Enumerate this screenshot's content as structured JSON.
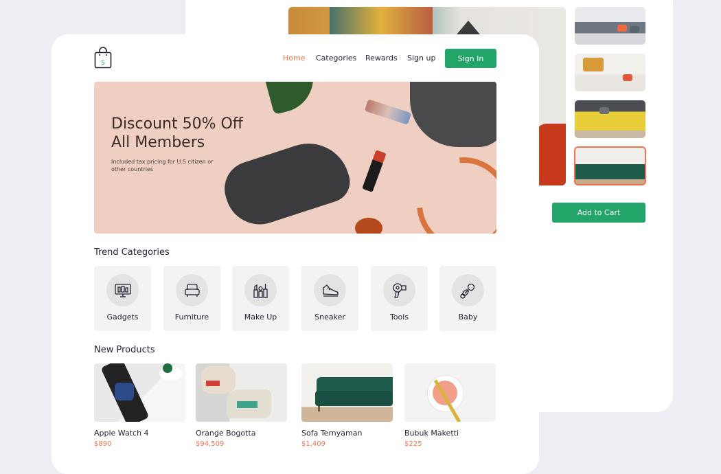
{
  "nav": {
    "items": [
      "Home",
      "Categories",
      "Rewards",
      "Sign up"
    ],
    "signin_label": "Sign In"
  },
  "hero": {
    "title_line1": "Discount 50% Off",
    "title_line2": "All Members",
    "subtitle": "Included tax pricing for U.S citizen or other countries"
  },
  "trend": {
    "title": "Trend Categories",
    "categories": [
      {
        "label": "Gadgets",
        "icon": "gadgets-icon"
      },
      {
        "label": "Furniture",
        "icon": "armchair-icon"
      },
      {
        "label": "Make Up",
        "icon": "makeup-icon"
      },
      {
        "label": "Sneaker",
        "icon": "sneaker-icon"
      },
      {
        "label": "Tools",
        "icon": "hair-dryer-icon"
      },
      {
        "label": "Baby",
        "icon": "pacifier-icon"
      }
    ]
  },
  "new_products": {
    "title": "New Products",
    "items": [
      {
        "name": "Apple Watch 4",
        "price": "$890"
      },
      {
        "name": "Orange Bogotta",
        "price": "$94,509"
      },
      {
        "name": "Sofa Ternyaman",
        "price": "$1,409"
      },
      {
        "name": "Bubuk Maketti",
        "price": "$225"
      }
    ]
  },
  "detail": {
    "add_to_cart_label": "Add to Cart"
  },
  "colors": {
    "accent_green": "#23a56a",
    "accent_orange": "#f07452"
  }
}
